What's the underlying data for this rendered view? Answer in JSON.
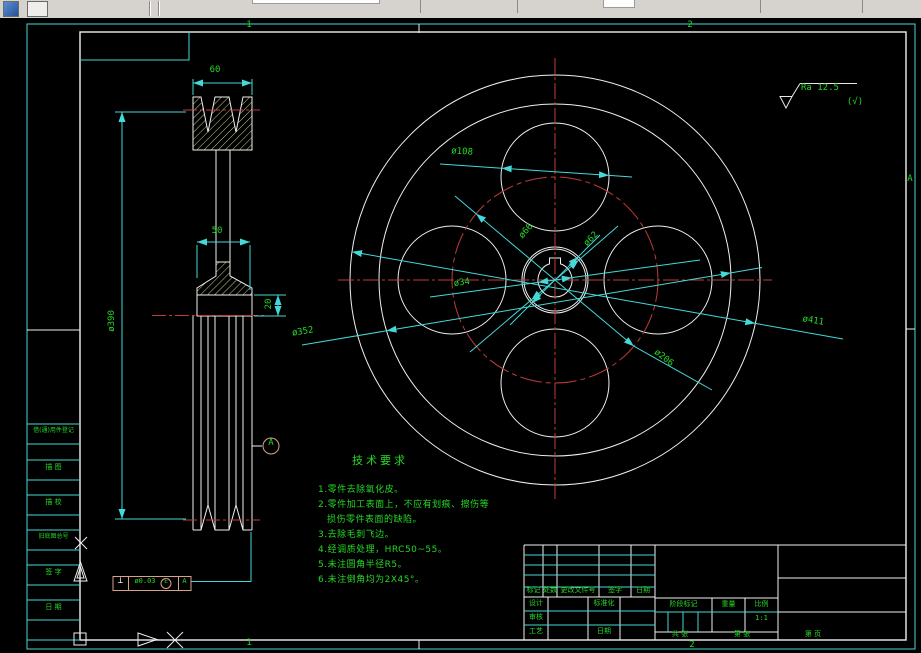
{
  "colors": {
    "cad_cyan": "#45d8d8",
    "cad_green": "#25d825",
    "cad_red": "#bf3b3b",
    "cad_white": "#f0f0f0",
    "frame_tan": "#d9a287",
    "toolbar_bg": "#d6d3ce"
  },
  "zones": {
    "top_1": "1",
    "top_2": "2",
    "bottom_1": "1",
    "bottom_2": "2",
    "right_a": "A"
  },
  "surface": {
    "ra_label": "Ra 12.5",
    "other_label": "(√)"
  },
  "left_view": {
    "dim_width": "60",
    "dim_hub": "50",
    "dim_key": "20",
    "dim_pitch": "ø390",
    "datum_label": "A",
    "fcf": {
      "sym": "⊥",
      "tol": "ø0.03",
      "mod": "E",
      "datum": "A"
    }
  },
  "front_view": {
    "dim_d108": "ø108",
    "dim_d66": "ø66",
    "dim_d62": "ø62",
    "dim_d34": "ø34",
    "dim_d352": "ø352",
    "dim_d411": "ø411",
    "dim_d206": "ø206"
  },
  "tech": {
    "title": "技术要求",
    "l1": "1.零件去除氧化皮。",
    "l2": "2.零件加工表面上，不应有划痕、擦伤等",
    "l2b": "损伤零件表面的缺陷。",
    "l3": "3.去除毛刺飞边。",
    "l4": "4.经调质处理，HRC50~55。",
    "l5": "5.未注圆角半径R5。",
    "l6": "6.未注倒角均为2X45°。"
  },
  "margin": {
    "r1": "借(通)用件登记",
    "r2": "描 图",
    "r3": "描 校",
    "r4": "旧底图总号",
    "r5": "签 字",
    "r6": "日 期"
  },
  "tb": {
    "mark": "标记",
    "count": "处数",
    "file": "更改文件号",
    "sign": "签字",
    "date": "日期",
    "design": "设计",
    "std": "标准化",
    "check": "审核",
    "craft": "工艺",
    "date2": "日期",
    "stage": "阶段标记",
    "weight": "重量",
    "scale_lbl": "比例",
    "scale_val": "1:1",
    "sheets": "共 张",
    "sheet_no": "第 张",
    "page": "第 页"
  }
}
